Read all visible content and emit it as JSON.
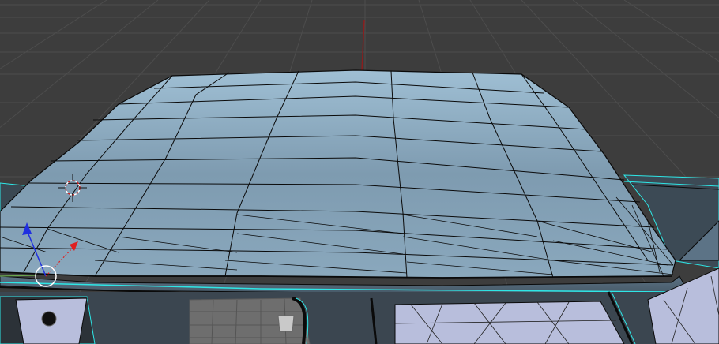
{
  "app": {
    "name": "3D Viewport",
    "mode": "edit-mode-wireframe-overlay",
    "view": "perspective"
  },
  "colors": {
    "background": "#3d3d3d",
    "grid_line": "#4a4a4a",
    "z_axis": "#8a1e1e",
    "y_axis": "#6aa84f",
    "mesh_face": "#7e9bb0",
    "mesh_face_light": "#9fbfd4",
    "mesh_face_dark": "#5c7386",
    "mesh_edge": "#0a0a0a",
    "selected_edge": "#2ee6e6",
    "underside": "#b8bedc",
    "gizmo_x": "#e02020",
    "gizmo_z": "#2030e0",
    "cursor": "#d02020"
  },
  "scene": {
    "object": "car-roof-mesh",
    "show_grid": true,
    "show_3d_cursor": true,
    "show_transform_gizmo": true
  }
}
